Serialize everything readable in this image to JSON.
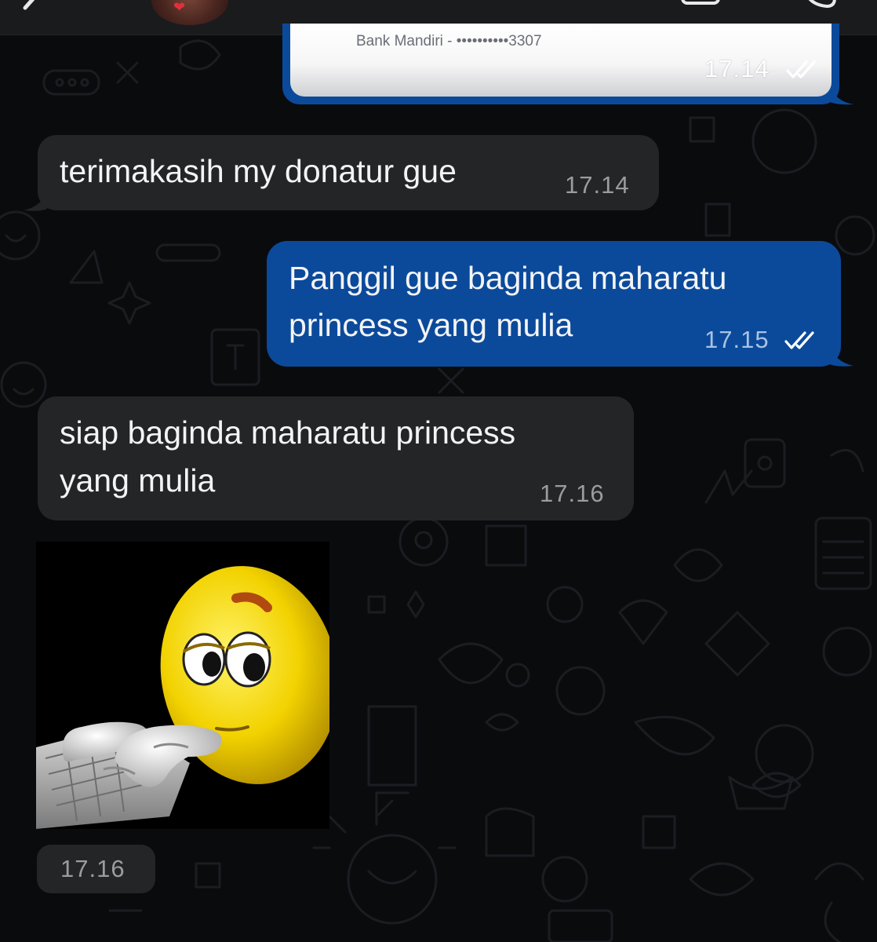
{
  "receipt": {
    "bank_text": "Bank Mandiri - ••••••••••3307",
    "time": "17.14"
  },
  "messages": [
    {
      "direction": "incoming",
      "text": "terimakasih my donatur gue",
      "time": "17.14"
    },
    {
      "direction": "outgoing",
      "line1": "Panggil gue baginda maharatu",
      "line2": "princess yang mulia",
      "time": "17.15"
    },
    {
      "direction": "incoming",
      "line1": "siap baginda maharatu princess",
      "line2": "yang mulia",
      "time": "17.16"
    }
  ],
  "sticker": {
    "time": "17.16"
  },
  "colors": {
    "incoming_bubble": "#242526",
    "outgoing_bubble": "#0b4a9b",
    "background": "#0a0b0d"
  }
}
